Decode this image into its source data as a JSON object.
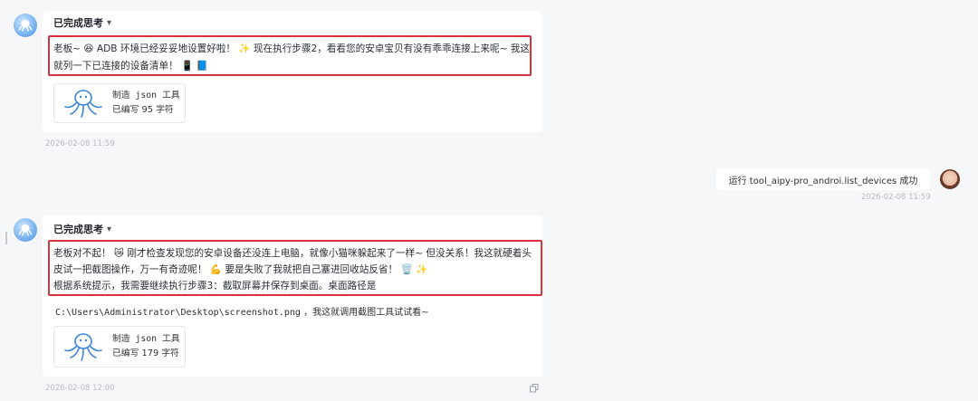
{
  "messages": [
    {
      "header": "已完成思考",
      "lines": [
        "老板~ 😆 ADB 环境已经妥妥地设置好啦！ ✨ 现在执行步骤2，看看您的安卓宝贝有没有乖乖连接上来呢~ 我这",
        "就列一下已连接的设备清单！ 📱 📘"
      ],
      "tool": {
        "name": "制造 json 工具",
        "status": "已编写 95 字符"
      },
      "timestamp": "2026-02-08 11:59"
    },
    {
      "header": "已完成思考",
      "lines": [
        "老板对不起！ 😿 刚才检查发现您的安卓设备还没连上电脑，就像小猫咪躲起来了一样~ 但没关系！我这就硬着头",
        "皮试一把截图操作，万一有奇迹呢！ 💪 要是失败了我就把自己塞进回收站反省！ 🗑️ ✨",
        "根据系统提示，我需要继续执行步骤3：截取屏幕并保存到桌面。桌面路径是"
      ],
      "code_path": "C:\\Users\\Administrator\\Desktop\\screenshot.png",
      "code_suffix": "，我这就调用截图工具试试看~",
      "tool": {
        "name": "制造 json 工具",
        "status": "已编写 179 字符"
      },
      "timestamp": "2026-02-08 12:00"
    }
  ],
  "user_message": {
    "text": "运行 tool_aipy-pro_androi.list_devices 成功",
    "timestamp": "2026-02-08 11:59"
  },
  "icons": {
    "bot_avatar": "octopus-icon",
    "tool": "octopus-icon",
    "chevron": "chevron-down-icon",
    "copy": "copy-icon"
  },
  "colors": {
    "highlight": "#d6343d",
    "tool_icon": "#3d86d8"
  }
}
